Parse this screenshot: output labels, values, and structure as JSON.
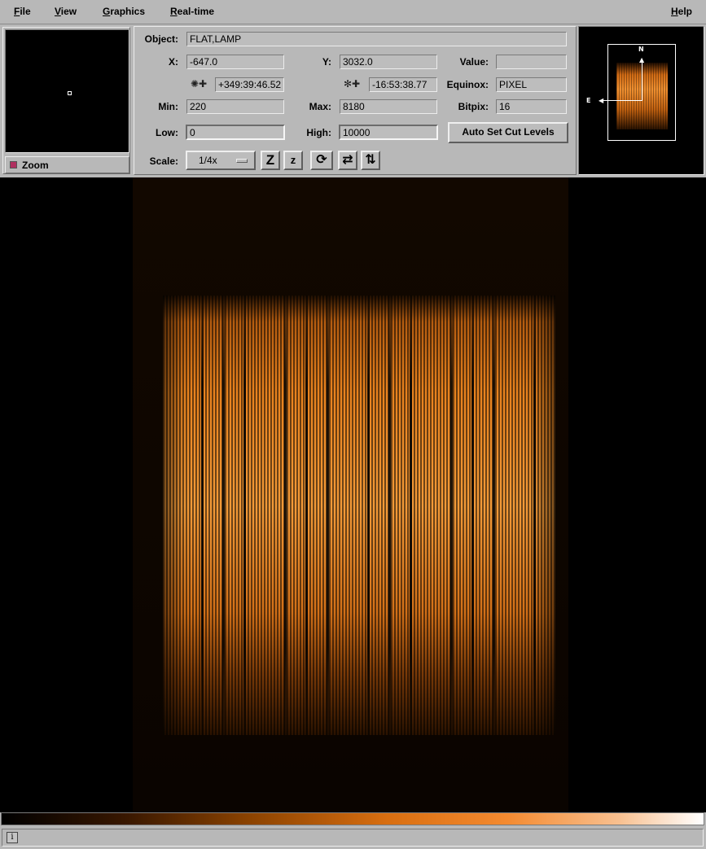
{
  "menubar": {
    "items": [
      {
        "mnemonic": "F",
        "rest": "ile"
      },
      {
        "mnemonic": "V",
        "rest": "iew"
      },
      {
        "mnemonic": "G",
        "rest": "raphics"
      },
      {
        "mnemonic": "R",
        "rest": "eal-time"
      }
    ],
    "help": {
      "mnemonic": "H",
      "rest": "elp"
    }
  },
  "zoom": {
    "label": "Zoom",
    "checked": true,
    "check_color": "#b03060"
  },
  "info": {
    "object_label": "Object:",
    "object_value": "FLAT,LAMP",
    "x_label": "X:",
    "x_value": "-647.0",
    "y_label": "Y:",
    "y_value": "3032.0",
    "value_label": "Value:",
    "value_value": "",
    "ra_value": "+349:39:46.52",
    "dec_value": "-16:53:38.77",
    "equinox_label": "Equinox:",
    "equinox_value": "PIXEL",
    "min_label": "Min:",
    "min_value": "220",
    "max_label": "Max:",
    "max_value": "8180",
    "bitpix_label": "Bitpix:",
    "bitpix_value": "16",
    "low_label": "Low:",
    "low_value": "0",
    "high_label": "High:",
    "high_value": "10000",
    "auto_cut_label": "Auto Set Cut Levels",
    "scale_label": "Scale:",
    "scale_value": "1/4x"
  },
  "toolbar": {
    "zoom_in_glyph": "Z",
    "zoom_out_glyph": "z",
    "rotate_glyph": "⟳",
    "flip_x_glyph": "⇄",
    "flip_y_glyph": "⇅"
  },
  "pan": {
    "north_label": "N",
    "east_label": "E"
  },
  "status": {
    "icon_glyph": "i"
  },
  "colors": {
    "background": "#b8b8b8",
    "image_accent": "#f09030"
  }
}
